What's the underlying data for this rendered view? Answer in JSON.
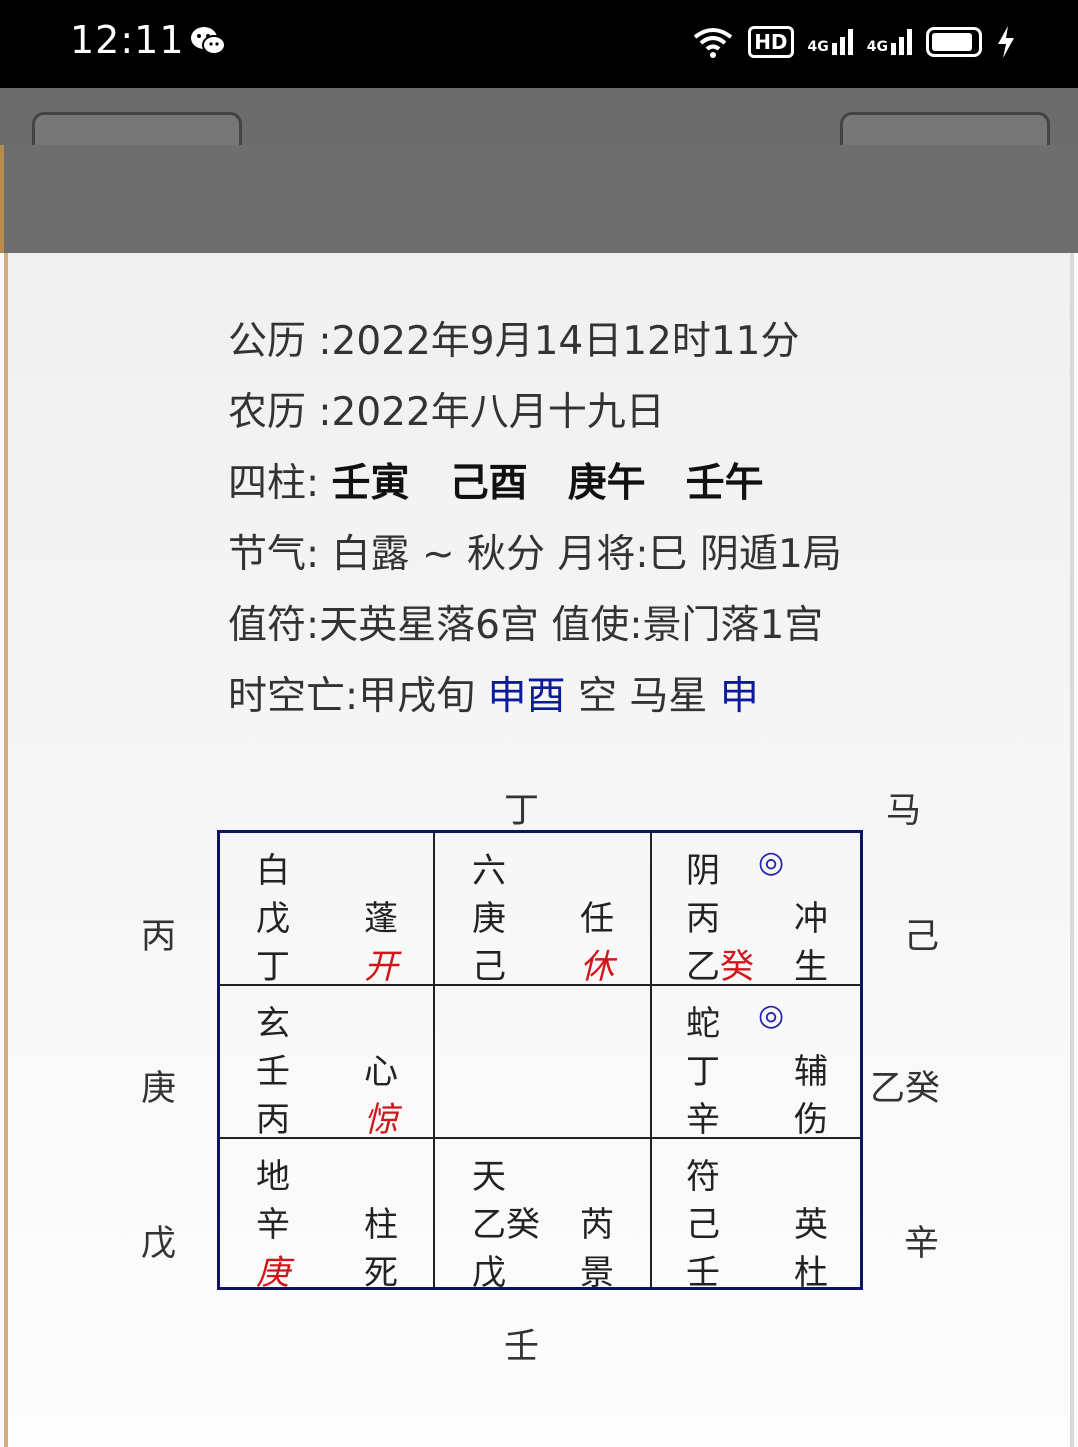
{
  "status": {
    "time": "12:11",
    "hd": "HD",
    "sig1": "4G",
    "sig2": "4G"
  },
  "info": {
    "solar_label": "公历 :",
    "solar_value": "2022年9月14日12时11分",
    "lunar_label": "农历 :",
    "lunar_value": "2022年八月十九日",
    "pillars_label": "四柱: ",
    "pillars": [
      "壬寅",
      "己酉",
      "庚午",
      "壬午"
    ],
    "jieqi_label": "节气: ",
    "jieqi_value": "白露 ~ 秋分 月将:巳 阴遁1局",
    "zhifu": "值符:天英星落6宫 值使:景门落1宫",
    "kongwang_label": "时空亡:甲戌旬 ",
    "kongwang_value": "申酉",
    "kong": " 空 马星 ",
    "ma_value": "申"
  },
  "outer": {
    "top": "丁",
    "top_right": "马",
    "left": [
      "丙",
      "庚",
      "戊"
    ],
    "right": [
      "己",
      "乙癸",
      "辛"
    ],
    "bottom": "壬"
  },
  "palaces": {
    "p0": {
      "god": "白",
      "a": "戊",
      "star": "蓬",
      "b": "丁",
      "door": "开"
    },
    "p1": {
      "god": "六",
      "a": "庚",
      "star": "任",
      "b": "己",
      "door": "休"
    },
    "p2": {
      "god": "阴",
      "mark": "◎",
      "a": "丙",
      "star": "冲",
      "b1": "乙",
      "b2": "癸",
      "door": "生"
    },
    "p3": {
      "god": "玄",
      "a": "壬",
      "star": "心",
      "b": "丙",
      "door": "惊"
    },
    "p5": {
      "god": "蛇",
      "mark": "◎",
      "a": "丁",
      "star": "辅",
      "b": "辛",
      "door": "伤"
    },
    "p6": {
      "god": "地",
      "a": "辛",
      "star": "柱",
      "b": "庚",
      "door": "死"
    },
    "p7": {
      "god": "天",
      "a": "乙癸",
      "star": "芮",
      "b": "戊",
      "door": "景"
    },
    "p8": {
      "god": "符",
      "a": "己",
      "star": "英",
      "b": "壬",
      "door": "杜"
    }
  },
  "colors": {
    "red": "#d2141b",
    "blue": "#0b1b9a",
    "grid": "#0c1466"
  }
}
